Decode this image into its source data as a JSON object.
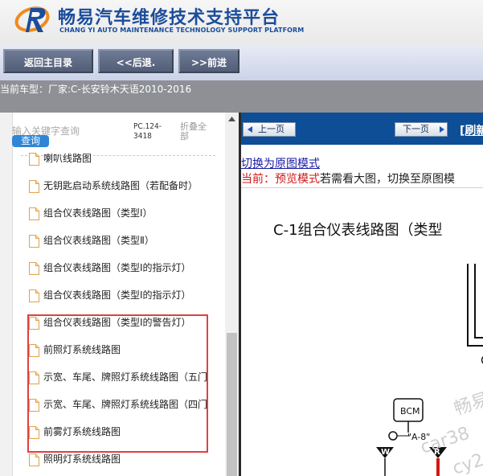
{
  "header": {
    "title_cn": "畅易汽车维修技术支持平台",
    "title_en": "CHANG YI AUTO MAINTENANCE TECHNOLOGY SUPPORT PLATFORM",
    "logo_letter": "R",
    "colors": {
      "brand_blue": "#1c4d9b",
      "logo_orange": "#f08a1c"
    }
  },
  "toolbar": {
    "home_label": "返回主目录",
    "back_label": "<<后退.",
    "forward_label": ">>前进"
  },
  "car_bar": {
    "text": "当前车型：厂家:C-长安铃木天语2010-2016"
  },
  "sidebar": {
    "search_placeholder": "输入关键字查询",
    "search_button": "查询",
    "pc_code": "PC.124-3418",
    "collapse_label": "折叠全部",
    "items": [
      {
        "label": "喇叭线路图",
        "highlighted": false
      },
      {
        "label": "无钥匙启动系统线路图（若配备时）",
        "highlighted": false
      },
      {
        "label": "组合仪表线路图（类型Ⅰ）",
        "highlighted": true
      },
      {
        "label": "组合仪表线路图（类型Ⅱ）",
        "highlighted": true
      },
      {
        "label": "组合仪表线路图（类型Ⅰ的指示灯）",
        "highlighted": true
      },
      {
        "label": "组合仪表线路图（类型Ⅰ的指示灯）",
        "highlighted": true
      },
      {
        "label": "组合仪表线路图（类型Ⅰ的警告灯）",
        "highlighted": true
      },
      {
        "label": "前照灯系统线路图",
        "highlighted": false
      },
      {
        "label": "示宽、车尾、牌照灯系统线路图（五门",
        "highlighted": false
      },
      {
        "label": "示宽、车尾、牌照灯系统线路图（四门",
        "highlighted": false
      },
      {
        "label": "前雾灯系统线路图",
        "highlighted": false
      },
      {
        "label": "照明灯系统线路图",
        "highlighted": false
      }
    ]
  },
  "content": {
    "prev_page": "上一页",
    "next_page": "下一页",
    "refresh": "[刷新",
    "switch_link": "切换为原图模式",
    "mode_prefix": "当前：",
    "mode_name": "预览模式",
    "mode_hint": "若需看大图，切换至原图模",
    "diagram": {
      "title": "C-1组合仪表线路图（类型",
      "bcm_label": "BCM",
      "connector_label": "\"A-8\"",
      "watermark_a": "畅易",
      "watermark_b": "car38",
      "watermark_c": "cy2",
      "wire_w": "W",
      "wire_r": "R"
    }
  }
}
